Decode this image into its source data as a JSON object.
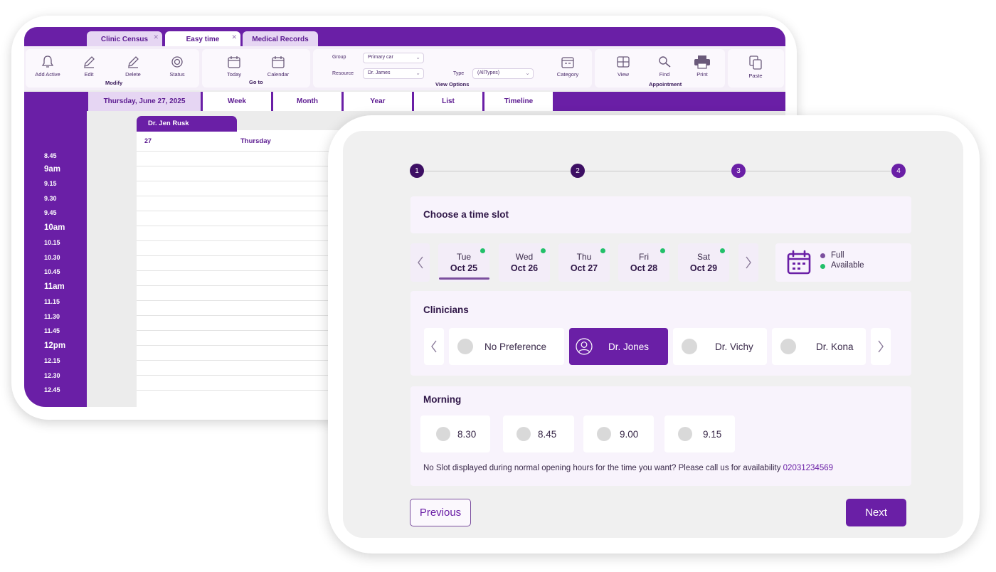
{
  "back_window": {
    "tabs": [
      {
        "label": "Clinic Census",
        "closable": true
      },
      {
        "label": "Easy time",
        "closable": true
      },
      {
        "label": "Medical Records",
        "closable": false
      }
    ],
    "ribbon": {
      "modify": {
        "label": "Modify",
        "buttons": [
          "Add Active",
          "Edit",
          "Delete",
          "Status"
        ]
      },
      "goto": {
        "label": "Go to",
        "buttons": [
          "Today",
          "Calendar"
        ]
      },
      "view_options": {
        "label": "View Options",
        "group_label": "Group",
        "group_value": "Primary car",
        "resource_label": "Resource",
        "resource_value": "Dr. James",
        "type_label": "Type",
        "type_value": "(AllTypes)",
        "category": "Category"
      },
      "appointment": {
        "label": "Appointment",
        "buttons": [
          "View",
          "Find",
          "Print"
        ]
      },
      "paste": "Paste"
    },
    "view_tabs": [
      "Thursday, June 27, 2025",
      "Week",
      "Month",
      "Year",
      "List",
      "Timeline"
    ],
    "doctor": "Dr. Jen Rusk",
    "day_number": "27",
    "day_name": "Thursday",
    "times": [
      "8.45",
      "9am",
      "9.15",
      "9.30",
      "9.45",
      "10am",
      "10.15",
      "10.30",
      "10.45",
      "11am",
      "11.15",
      "11.30",
      "11.45",
      "12pm",
      "12.15",
      "12.30",
      "12.45"
    ]
  },
  "booking": {
    "steps": [
      "1",
      "2",
      "3",
      "4"
    ],
    "time_slot_title": "Choose a time slot",
    "days": [
      {
        "name": "Tue",
        "date": "Oct 25",
        "available": true,
        "selected": true
      },
      {
        "name": "Wed",
        "date": "Oct 26",
        "available": true,
        "selected": false
      },
      {
        "name": "Thu",
        "date": "Oct 27",
        "available": true,
        "selected": false
      },
      {
        "name": "Fri",
        "date": "Oct 28",
        "available": true,
        "selected": false
      },
      {
        "name": "Sat",
        "date": "Oct 29",
        "available": true,
        "selected": false
      }
    ],
    "legend": {
      "full": "Full",
      "available": "Available"
    },
    "clinicians_title": "Clinicians",
    "clinicians": [
      {
        "name": "No Preference",
        "selected": false
      },
      {
        "name": "Dr. Jones",
        "selected": true
      },
      {
        "name": "Dr. Vichy",
        "selected": false
      },
      {
        "name": "Dr. Kona",
        "selected": false
      }
    ],
    "morning_title": "Morning",
    "slots": [
      "8.30",
      "8.45",
      "9.00",
      "9.15"
    ],
    "notice": "No Slot displayed during normal opening hours for the time you want? Please call us for availability",
    "phone": "02031234569",
    "previous": "Previous",
    "next": "Next"
  },
  "colors": {
    "brand": "#6a1fa6",
    "step_dark": "#3d0f63",
    "available": "#22c06a",
    "full": "#7b4f9e",
    "tab_inactive": "#e6d6f3"
  },
  "icons": [
    "bell-icon",
    "pencil-icon",
    "pencil-icon",
    "status-icon",
    "calendar-icon",
    "calendar-icon",
    "category-icon",
    "grid-icon",
    "search-icon",
    "printer-icon",
    "copy-icon",
    "chevron-left-icon",
    "chevron-right-icon",
    "calendar-icon",
    "user-icon",
    "clock-icon"
  ]
}
